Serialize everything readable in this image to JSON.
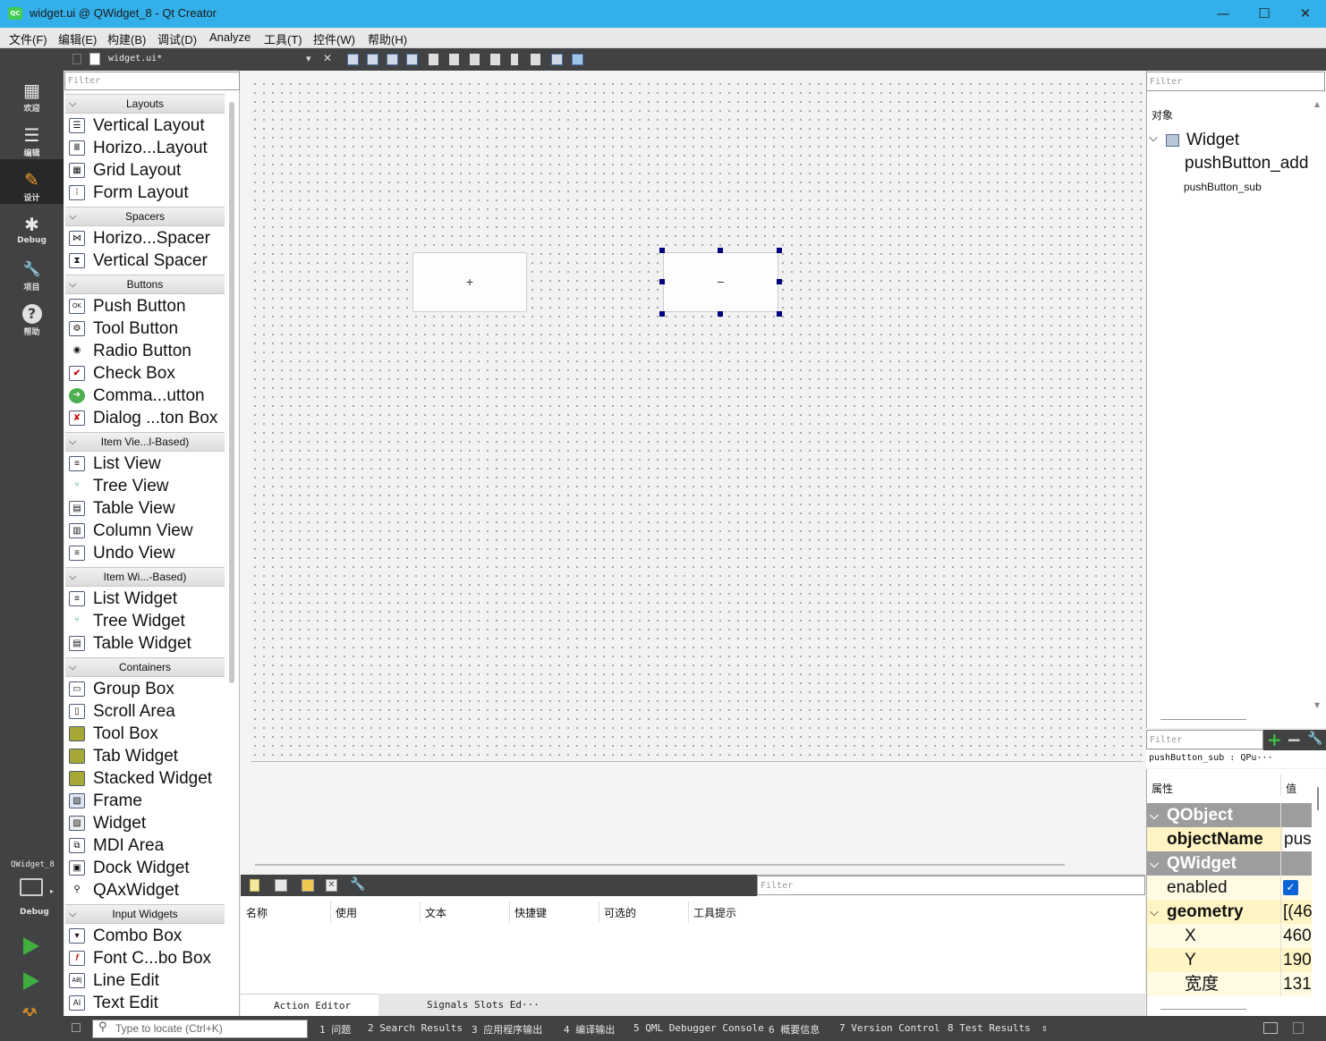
{
  "window": {
    "title": "widget.ui @ QWidget_8 - Qt Creator",
    "app_icon": "qt-icon",
    "minimize": "—",
    "maximize": "☐",
    "close": "✕"
  },
  "menu": [
    "文件(F)",
    "编辑(E)",
    "构建(B)",
    "调试(D)",
    "Analyze",
    "工具(T)",
    "控件(W)",
    "帮助(H)"
  ],
  "modes": [
    {
      "label": "欢迎",
      "icon": "grid-icon",
      "glyph": "▦"
    },
    {
      "label": "编辑",
      "icon": "document-icon",
      "glyph": "☰"
    },
    {
      "label": "设计",
      "icon": "pencil-icon",
      "glyph": "✎"
    },
    {
      "label": "Debug",
      "icon": "bug-icon",
      "glyph": "✱"
    },
    {
      "label": "项目",
      "icon": "wrench-icon",
      "glyph": "🔧"
    },
    {
      "label": "帮助",
      "icon": "help-icon",
      "glyph": "?"
    }
  ],
  "target": {
    "project": "QWidget_8",
    "label": "Debug"
  },
  "editor": {
    "filename": "widget.ui*",
    "dropdown": "▾",
    "close": "✕"
  },
  "widgetbox": {
    "filter_placeholder": "Filter",
    "categories": [
      {
        "name": "Layouts",
        "items": [
          "Vertical Layout",
          "Horizo...Layout",
          "Grid Layout",
          "Form Layout"
        ]
      },
      {
        "name": "Spacers",
        "items": [
          "Horizo...Spacer",
          "Vertical Spacer"
        ]
      },
      {
        "name": "Buttons",
        "items": [
          "Push Button",
          "Tool Button",
          "Radio Button",
          "Check Box",
          "Comma...utton",
          "Dialog ...ton Box"
        ]
      },
      {
        "name": "Item Vie...l-Based)",
        "items": [
          "List View",
          "Tree View",
          "Table View",
          "Column View",
          "Undo View"
        ]
      },
      {
        "name": "Item Wi...-Based)",
        "items": [
          "List Widget",
          "Tree Widget",
          "Table Widget"
        ]
      },
      {
        "name": "Containers",
        "items": [
          "Group Box",
          "Scroll Area",
          "Tool Box",
          "Tab Widget",
          "Stacked Widget",
          "Frame",
          "Widget",
          "MDI Area",
          "Dock Widget",
          "QAxWidget"
        ]
      },
      {
        "name": "Input Widgets",
        "items": [
          "Combo Box",
          "Font C...bo Box",
          "Line Edit",
          "Text Edit"
        ]
      }
    ]
  },
  "form": {
    "button_add": "+",
    "button_sub": "−"
  },
  "action_editor": {
    "filter_placeholder": "Filter",
    "columns": [
      "名称",
      "使用",
      "文本",
      "快捷键",
      "可选的",
      "工具提示"
    ],
    "tabs": [
      "Action Editor",
      "Signals  Slots Ed···"
    ]
  },
  "object_inspector": {
    "filter_placeholder": "Filter",
    "header": "对象",
    "root": "Widget",
    "children": [
      "pushButton_add",
      "pushButton_sub"
    ]
  },
  "property_editor": {
    "filter_placeholder": "Filter",
    "object": "pushButton_sub : QPu···",
    "col_property": "属性",
    "col_value": "值",
    "rows": [
      {
        "name": "QObject",
        "value": "",
        "type": "group"
      },
      {
        "name": "objectName",
        "value": "pus",
        "type": "bold"
      },
      {
        "name": "QWidget",
        "value": "",
        "type": "group"
      },
      {
        "name": "enabled",
        "value": "✓",
        "type": "check"
      },
      {
        "name": "geometry",
        "value": "[(46",
        "type": "bold"
      },
      {
        "name": "X",
        "value": "460",
        "type": "sub"
      },
      {
        "name": "Y",
        "value": "190",
        "type": "sub"
      },
      {
        "name": "宽度",
        "value": "131",
        "type": "sub"
      }
    ]
  },
  "statusbar": {
    "locate_placeholder": "Type to locate (Ctrl+K)",
    "tabs": [
      "1  问题",
      "2  Search Results",
      "3  应用程序输出",
      "4  编译输出",
      "5  QML Debugger Console",
      "6  概要信息",
      "7  Version Control",
      "8  Test Results"
    ]
  },
  "colors": {
    "titlebar": "#33b0ea",
    "sidebar": "#404244",
    "selection_handle": "#000080",
    "group_header": "#9d9d9d",
    "changed_prop": "#fff4c4"
  }
}
